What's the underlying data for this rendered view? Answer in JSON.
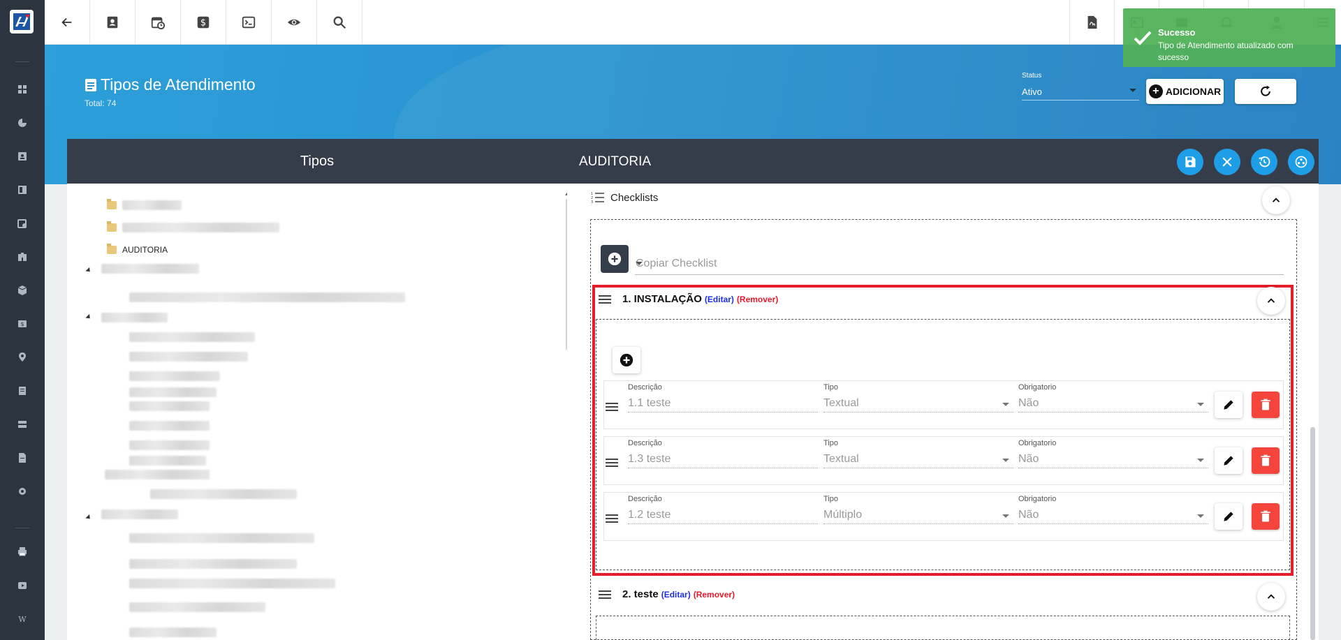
{
  "topbar": {
    "left_icons": [
      "back-arrow-icon",
      "contact-card-icon",
      "clock-calendar-icon",
      "dollar-icon",
      "terminal-icon",
      "eye-icon",
      "search-icon"
    ],
    "right_icons": [
      "pdf-icon",
      "badge-icon",
      "mail-icon",
      "bell-icon",
      "avatar",
      "list-icon"
    ]
  },
  "toast": {
    "title": "Sucesso",
    "message": "Tipo de Atendimento atualizado com sucesso"
  },
  "page": {
    "title": "Tipos de Atendimento",
    "total": "Total: 74"
  },
  "status": {
    "label": "Status",
    "value": "Ativo"
  },
  "buttons": {
    "add": "ADICIONAR"
  },
  "left_panel": {
    "title": "Tipos",
    "visible_node": "AUDITORIA"
  },
  "right_panel": {
    "title": "AUDITORIA",
    "section_title": "Checklists",
    "copy_placeholder": "Copiar Checklist",
    "groups": [
      {
        "title": "1. INSTALAÇÃO",
        "edit": "(Editar)",
        "remove": "(Remover)",
        "items": [
          {
            "desc_label": "Descrição",
            "desc": "1.1 teste",
            "type_label": "Tipo",
            "type": "Textual",
            "req_label": "Obrigatorio",
            "req": "Não"
          },
          {
            "desc_label": "Descrição",
            "desc": "1.3 teste",
            "type_label": "Tipo",
            "type": "Textual",
            "req_label": "Obrigatorio",
            "req": "Não"
          },
          {
            "desc_label": "Descrição",
            "desc": "1.2 teste",
            "type_label": "Tipo",
            "type": "Múltiplo",
            "req_label": "Obrigatorio",
            "req": "Não"
          }
        ]
      },
      {
        "title": "2. teste",
        "edit": "(Editar)",
        "remove": "(Remover)"
      }
    ]
  },
  "colors": {
    "rail": "#2c3440",
    "banner": "#2891cf",
    "header": "#353d4a",
    "accent_blue": "#1f9ee8",
    "danger": "#f4443c",
    "success_toast": "#51b158",
    "highlight_box": "#e51d2a"
  }
}
